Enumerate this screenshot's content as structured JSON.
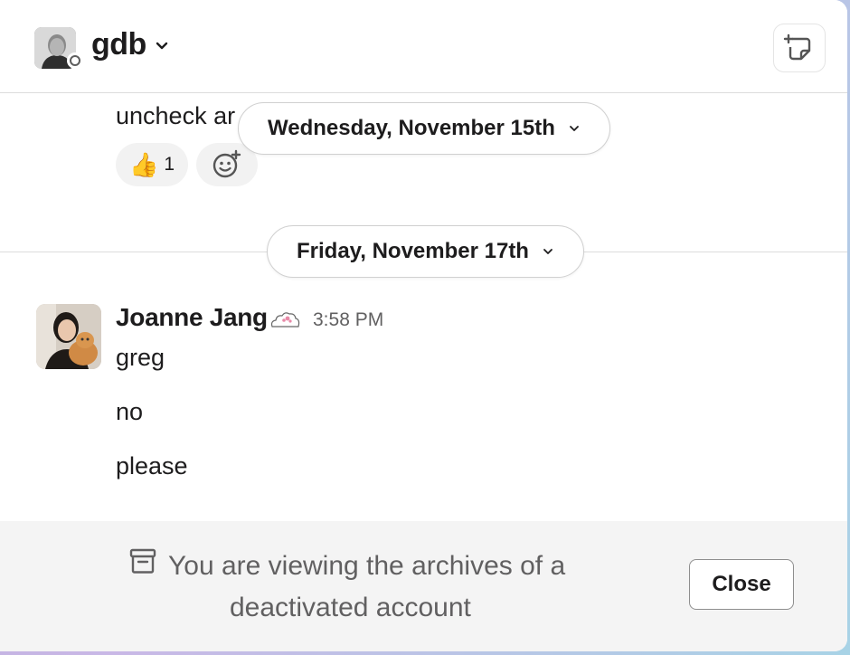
{
  "header": {
    "name": "gdb",
    "avatar_icon": "user-avatar",
    "presence": "away",
    "new_note_icon": "compose-note-icon"
  },
  "messages_above": {
    "partial_text": "uncheck ar",
    "reaction": {
      "emoji": "👍",
      "count": "1"
    },
    "add_reaction_icon": "add-emoji-icon"
  },
  "dates": [
    {
      "label": "Wednesday, November 15th"
    },
    {
      "label": "Friday, November 17th"
    }
  ],
  "message": {
    "author": "Joanne Jang",
    "status_emoji": "cloud-icon",
    "time": "3:58 PM",
    "lines": [
      "greg",
      "no",
      "please"
    ]
  },
  "footer": {
    "notice_line1": "You are viewing the archives of a",
    "notice_line2": "deactivated account",
    "close_label": "Close",
    "icon": "archive-icon"
  }
}
